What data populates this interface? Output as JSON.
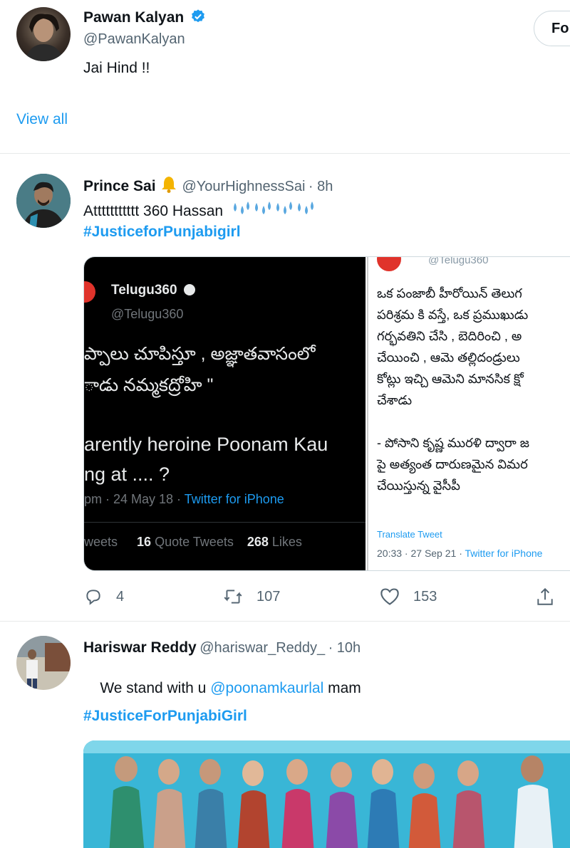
{
  "tweet1": {
    "name": "Pawan Kalyan",
    "handle": "@PawanKalyan",
    "text": "Jai Hind !!",
    "follow_label": "Fo",
    "view_all": "View all"
  },
  "tweet2": {
    "name": "Prince Sai",
    "handle": "@YourHighnessSai",
    "time": "· 8h",
    "text": "Attttttttttt 360 Hassan",
    "hashtag": "#JusticeforPunjabigirl",
    "embed_left": {
      "account": "Telugu360",
      "handle": "@Telugu360",
      "telugu_line1": "ప్పాలు చూపిస్తూ , అజ్ఞాతవాసంలో",
      "telugu_line2": "ాడు నమ్మకద్రోహి \"",
      "english_line1": "arently heroine Poonam Kau",
      "english_line2": "ng at  .... ?",
      "meta": "pm · 24 May 18 · ",
      "meta_source": "Twitter for iPhone",
      "stats_prefix": "weets",
      "quote_count": "16",
      "quote_label": "Quote Tweets",
      "likes_count": "268",
      "likes_label": "Likes"
    },
    "embed_right": {
      "handle": "@Telugu360",
      "lines": [
        "ఒక పంజాబీ హీరోయిన్  తెలుగ",
        "పరిశ్రమ కి వస్తే, ఒక ప్రముఖుడు",
        "గర్భవతిని చేసి , బెదిరించి , అ",
        "చేయించి , ఆమె తల్లిదండ్రులు",
        "కోట్లు ఇచ్చి ఆమెని మానసిక క్షో",
        "చేశాడు",
        "",
        "- పోసాని కృష్ణ మురళి ద్వారా జ",
        "పై అత్యంత దారుణమైన విమర",
        "చేయిస్తున్న వైసీపీ"
      ],
      "translate": "Translate Tweet",
      "meta": "20:33 · 27 Sep 21 · ",
      "meta_source": "Twitter for iPhone"
    },
    "replies": "4",
    "retweets": "107",
    "likes": "153"
  },
  "tweet3": {
    "name": "Hariswar Reddy",
    "handle": "@hariswar_Reddy_",
    "time": "· 10h",
    "text_before": "We stand with u ",
    "mention": "@poonamkaurlal",
    "text_after": " mam",
    "hashtag": "#JusticeForPunjabiGirl"
  },
  "colors": {
    "accent": "#1d9bf0",
    "text": "#0f1419",
    "secondary": "#536471"
  }
}
